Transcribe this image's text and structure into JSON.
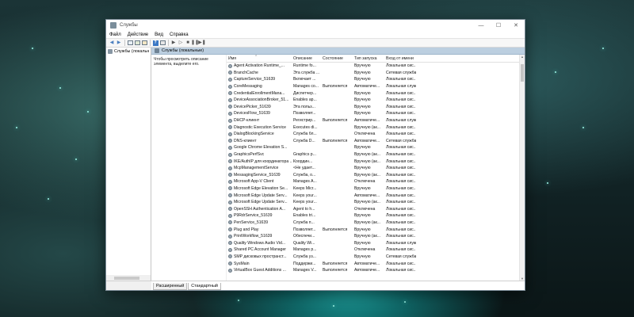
{
  "window": {
    "title": "Службы"
  },
  "menu": [
    "Файл",
    "Действие",
    "Вид",
    "Справка"
  ],
  "toolbar": {
    "icons": [
      "back-icon",
      "forward-icon",
      "console-tree-icon",
      "refresh-icon",
      "export-icon",
      "help-icon",
      "properties-icon",
      "start-icon",
      "start-alt-icon",
      "stop-icon",
      "pause-icon",
      "restart-icon"
    ]
  },
  "tree": {
    "item_label": "Службы (локальн"
  },
  "main": {
    "header": "Службы (локальные)",
    "description": "Чтобы просмотреть описание элемента, выделите его."
  },
  "columns": [
    "Имя",
    "Описание",
    "Состояние",
    "Тип запуска",
    "Вход от имени"
  ],
  "rows": [
    [
      "Agent Activation Runtime_...",
      "Runtime fo...",
      "",
      "Вручную",
      "Локальная сис..."
    ],
    [
      "BranchCache",
      "Эта служба ...",
      "",
      "Вручную",
      "Сетевая служба"
    ],
    [
      "CaptureService_51639",
      "Включает ...",
      "",
      "Вручную",
      "Локальная сис..."
    ],
    [
      "CoreMessaging",
      "Manages co...",
      "Выполняется",
      "Автоматиче...",
      "Локальная служба"
    ],
    [
      "CredentialEnrollmentMana...",
      "Диспетчер...",
      "",
      "Вручную",
      "Локальная сис..."
    ],
    [
      "DeviceAssociationBroker_51...",
      "Enables ap...",
      "",
      "Вручную",
      "Локальная сис..."
    ],
    [
      "DevicePicker_51639",
      "Эта польз...",
      "",
      "Вручную",
      "Локальная сис..."
    ],
    [
      "DevicesFlow_51639",
      "Позволяет...",
      "",
      "Вручную",
      "Локальная сис..."
    ],
    [
      "DHCP-клиент",
      "Регистрир...",
      "Выполняется",
      "Автоматиче...",
      "Локальная служба"
    ],
    [
      "Diagnostic Execution Service",
      "Executes di...",
      "",
      "Вручную (ак...",
      "Локальная сис..."
    ],
    [
      "DialogBlockingService",
      "Служба бл...",
      "",
      "Отключена",
      "Локальная сис..."
    ],
    [
      "DNS-клиент",
      "Служба D...",
      "Выполняется",
      "Автоматиче...",
      "Сетевая служба"
    ],
    [
      "Google Chrome Elevation S...",
      "",
      "",
      "Вручную",
      "Локальная сис..."
    ],
    [
      "GraphicsPerfSvc",
      "Graphics p...",
      "",
      "Вручную (ак...",
      "Локальная сис..."
    ],
    [
      "IKE/AuthIP для координатора ...",
      "Координ...",
      "",
      "Вручную (ак...",
      "Локальная сис..."
    ],
    [
      "McpManagementService",
      "<Не удает...",
      "",
      "Вручную",
      "Локальная сис..."
    ],
    [
      "MessagingService_51639",
      "Служба, о...",
      "",
      "Вручную (ак...",
      "Локальная сис..."
    ],
    [
      "Microsoft App-V Client",
      "Manages A...",
      "",
      "Отключена",
      "Локальная сис..."
    ],
    [
      "Microsoft Edge Elevation Se...",
      "Keeps Micr...",
      "",
      "Вручную",
      "Локальная сис..."
    ],
    [
      "Microsoft Edge Update Serv...",
      "Keeps your...",
      "",
      "Автоматиче...",
      "Локальная сис..."
    ],
    [
      "Microsoft Edge Update Serv...",
      "Keeps your...",
      "",
      "Вручную (ак...",
      "Локальная сис..."
    ],
    [
      "OpenSSH Authentication A...",
      "Agent to h...",
      "",
      "Отключена",
      "Локальная сис..."
    ],
    [
      "P9RdrService_51639",
      "Enables tri...",
      "",
      "Вручную",
      "Локальная сис..."
    ],
    [
      "PenService_51639",
      "Служба п...",
      "",
      "Вручную (ак...",
      "Локальная сис..."
    ],
    [
      "Plug and Play",
      "Позволяет...",
      "Выполняется",
      "Вручную",
      "Локальная сис..."
    ],
    [
      "PrintWorkflow_51639",
      "Обеспечи...",
      "",
      "Вручную (ак...",
      "Локальная сис..."
    ],
    [
      "Quality Windows Audio Vid...",
      "Quality Wi...",
      "",
      "Вручную",
      "Локальная служба"
    ],
    [
      "Shared PC Account Manager",
      "Manages p...",
      "",
      "Отключена",
      "Локальная сис..."
    ],
    [
      "SMP дисковых пространст...",
      "Служба уз...",
      "",
      "Вручную",
      "Сетевая служба"
    ],
    [
      "SysMain",
      "Поддержи...",
      "Выполняется",
      "Автоматиче...",
      "Локальная сис..."
    ],
    [
      "VirtualBox Guest Additions ...",
      "Manages V...",
      "Выполняется",
      "Автоматиче...",
      "Локальная сис..."
    ]
  ],
  "tabs": [
    "Расширенный",
    "Стандартный"
  ]
}
